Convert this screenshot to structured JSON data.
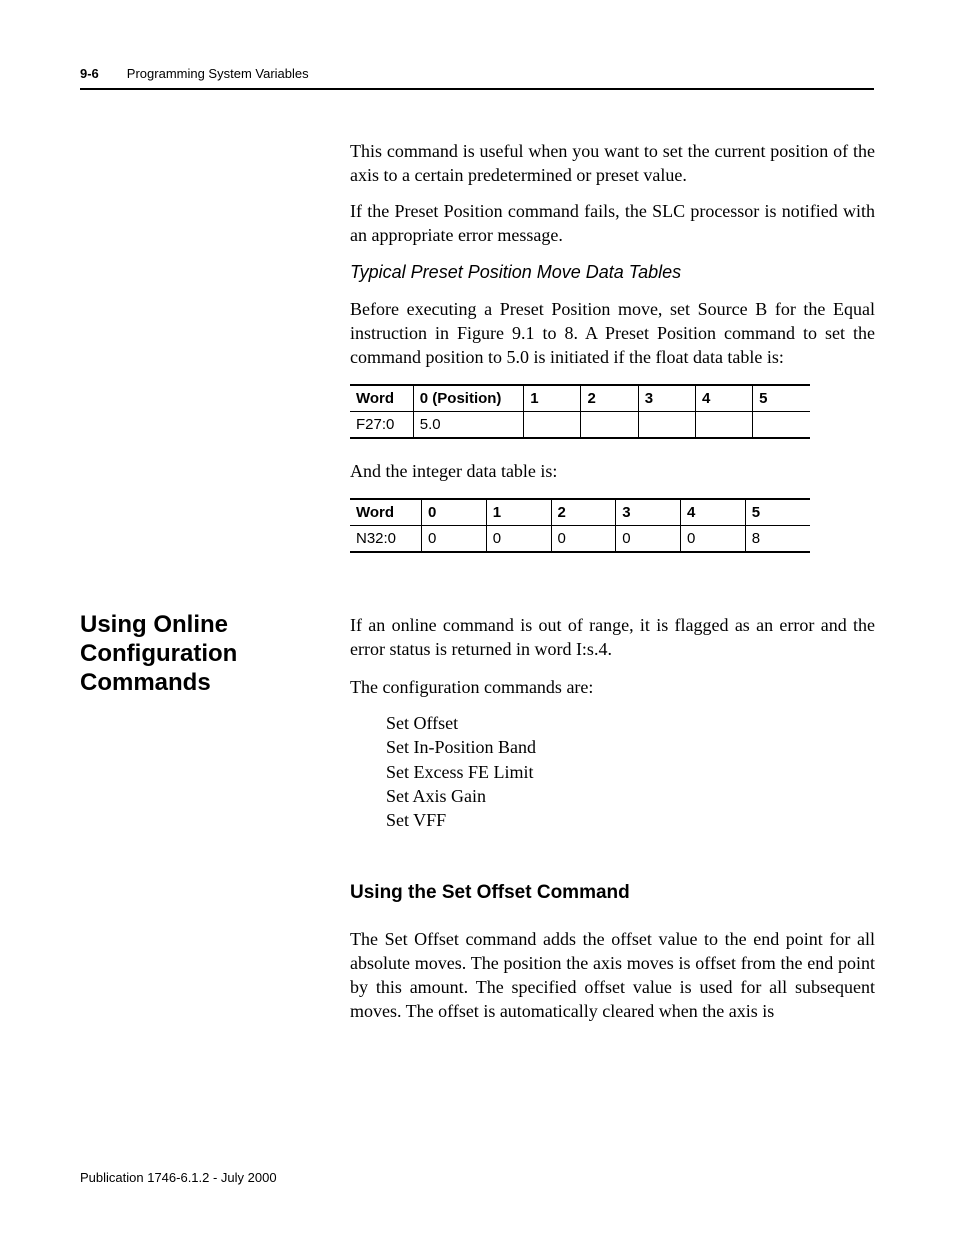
{
  "header": {
    "page_num": "9-6",
    "chapter": "Programming System Variables"
  },
  "body": {
    "p1": "This command is useful when you want to set the current position of the axis to a certain predetermined or preset value.",
    "p2": "If the Preset Position command fails, the SLC processor is notified with an appropriate error message.",
    "sub1": "Typical Preset Position Move Data Tables",
    "p3": "Before executing a Preset Position move, set Source B for the Equal instruction in Figure 9.1 to 8. A Preset Position command to set the command position to 5.0 is initiated if the float data table is:",
    "table1": {
      "headers": [
        "Word",
        "0 (Position)",
        "1",
        "2",
        "3",
        "4",
        "5"
      ],
      "row": [
        "F27:0",
        "5.0",
        "",
        "",
        "",
        "",
        ""
      ]
    },
    "p4": "And the integer data table is:",
    "table2": {
      "headers": [
        "Word",
        "0",
        "1",
        "2",
        "3",
        "4",
        "5"
      ],
      "row": [
        "N32:0",
        "0",
        "0",
        "0",
        "0",
        "0",
        "8"
      ]
    },
    "section_heading": "Using Online Configuration Commands",
    "p5": "If an online command is out of range, it is flagged as an error and the error status is returned in word I:s.4.",
    "p6": "The configuration commands are:",
    "list": [
      "Set Offset",
      "Set In-Position Band",
      "Set Excess FE Limit",
      "Set Axis Gain",
      "Set VFF"
    ],
    "subsection_heading": "Using the Set Offset Command",
    "p7": "The Set Offset command adds the offset value to the end point for all absolute moves. The position the axis moves is offset from the end point by this amount. The specified offset value is used for all subsequent moves. The offset is automatically cleared when the axis is"
  },
  "footer": {
    "text": "Publication 1746-6.1.2 - July 2000"
  }
}
